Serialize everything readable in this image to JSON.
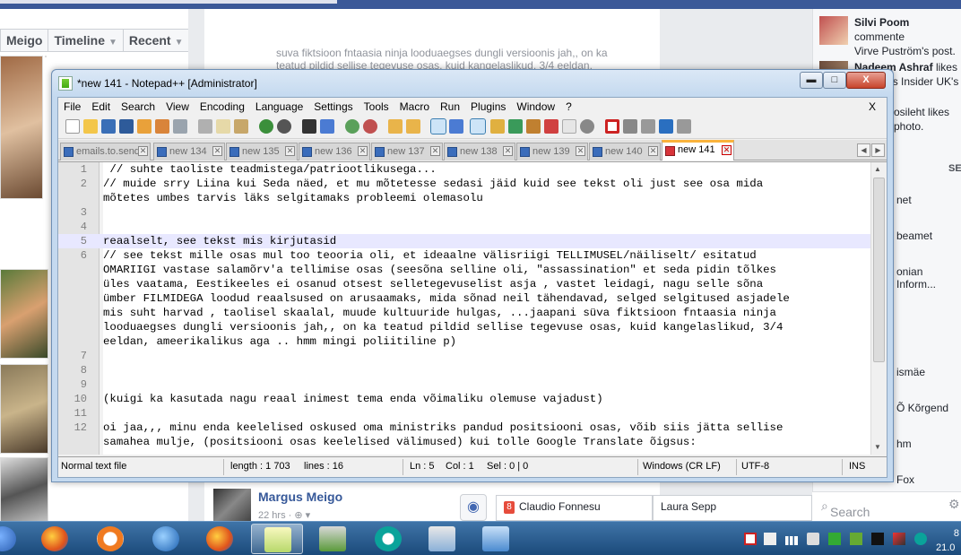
{
  "facebook": {
    "tabs": [
      {
        "label": "Meigo",
        "has_arrow": false
      },
      {
        "label": "Timeline",
        "has_arrow": true
      },
      {
        "label": "Recent",
        "has_arrow": true
      }
    ],
    "post_snippet": "suva fiktsioon fntaasia ninja looduaegses dungli versioonis jah,, on ka teatud pildid sellise tegevuse osas, kuid kangelaslikud, 3/4 eeldan,",
    "post_author": "Margus Meigo",
    "post_time": "22 hrs · ⊕ ▾",
    "chat_tabs": [
      {
        "badge": "8",
        "name": "Claudio Fonnesu"
      },
      {
        "badge": "",
        "name": "Laura Sepp"
      }
    ],
    "ticker": [
      {
        "name": "Silvi Poom",
        "line1": "commente",
        "line2": "Virve Puström's post."
      },
      {
        "name": "Nadeem Ashraf",
        "line1": "likes",
        "line2": "Business Insider UK's"
      },
      {
        "name": "",
        "line1": "osileht likes",
        "line2": "photo."
      }
    ],
    "sidebar_header": "SE",
    "sidebar_names": [
      "net",
      "beamet",
      "onian Inform...",
      "ismäe",
      "Õ Kõrgend",
      "hm",
      "Fox"
    ],
    "search_placeholder": "Search",
    "colors": {
      "topbar": "#3b5998",
      "link": "#365899"
    }
  },
  "notepad": {
    "title": "*new 141 - Notepad++ [Administrator]",
    "window_buttons": {
      "minimize": "▬",
      "maximize": "□",
      "close": "X"
    },
    "menu": [
      "File",
      "Edit",
      "Search",
      "View",
      "Encoding",
      "Language",
      "Settings",
      "Tools",
      "Macro",
      "Run",
      "Plugins",
      "Window",
      "?"
    ],
    "menu_close": "X",
    "tabs": [
      {
        "label": "emails.to.send",
        "active": false
      },
      {
        "label": "new 134",
        "active": false
      },
      {
        "label": "new 135",
        "active": false
      },
      {
        "label": "new 136",
        "active": false
      },
      {
        "label": "new 137",
        "active": false
      },
      {
        "label": "new 138",
        "active": false
      },
      {
        "label": "new 139",
        "active": false
      },
      {
        "label": "new 140",
        "active": false
      },
      {
        "label": "new 141",
        "active": true
      }
    ],
    "lines": [
      {
        "num": "1",
        "text": " // suhte taoliste teadmistega/patriootlikusega..."
      },
      {
        "num": "2",
        "text": "// muide srry Liina kui Seda näed, et mu mõtetesse sedasi jäid kuid see tekst oli just see osa mida"
      },
      {
        "num": "",
        "text": "mõtetes umbes tarvis läks selgitamaks probleemi olemasolu"
      },
      {
        "num": "3",
        "text": ""
      },
      {
        "num": "4",
        "text": ""
      },
      {
        "num": "5",
        "text": "reaalselt, see tekst mis kirjutasid",
        "current": true
      },
      {
        "num": "6",
        "text": "// see tekst mille osas mul too teooria oli, et ideaalne välisriigi TELLIMUSEL/näiliselt/ esitatud"
      },
      {
        "num": "",
        "text": "OMARIIGI vastase salamõrv'a tellimise osas (seesõna selline oli, \"assassination\" et seda pidin tõlkes"
      },
      {
        "num": "",
        "text": "üles vaatama, Eestikeeles ei osanud otsest selletegevuselist asja , vastet leidagi, nagu selle sõna"
      },
      {
        "num": "",
        "text": "ümber FILMIDEGA loodud reaalsused on arusaamaks, mida sõnad neil tähendavad, selged selgitused asjadele"
      },
      {
        "num": "",
        "text": "mis suht harvad , taolisel skaalal, muude kultuuride hulgas, ...jaapani süva fiktsioon fntaasia ninja"
      },
      {
        "num": "",
        "text": "looduaegses dungli versioonis jah,, on ka teatud pildid sellise tegevuse osas, kuid kangelaslikud, 3/4"
      },
      {
        "num": "",
        "text": "eeldan, ameerikalikus aga .. hmm mingi poliitiline p)"
      },
      {
        "num": "7",
        "text": ""
      },
      {
        "num": "8",
        "text": ""
      },
      {
        "num": "9",
        "text": ""
      },
      {
        "num": "10",
        "text": "(kuigi ka kasutada nagu reaal inimest tema enda võimaliku olemuse vajadust)"
      },
      {
        "num": "11",
        "text": ""
      },
      {
        "num": "12",
        "text": "oi jaa,,, minu enda keelelised oskused oma ministriks pandud positsiooni osas, võib siis jätta sellise"
      },
      {
        "num": "",
        "text": "samahea mulje, (positsiooni osas keelelised välimused) kui tolle Google Translate õigsus:"
      }
    ],
    "status": {
      "type": "Normal text file",
      "length": "length : 1 703",
      "lines": "lines : 16",
      "ln": "Ln : 5",
      "col": "Col : 1",
      "sel": "Sel : 0 | 0",
      "eol": "Windows (CR LF)",
      "encoding": "UTF-8",
      "mode": "INS"
    },
    "colors": {
      "active_tab_accent": "#fab33c",
      "current_line": "#e8e8ff"
    }
  },
  "taskbar": {
    "apps": [
      "firefox-icon",
      "avast-icon",
      "thunderbird-icon",
      "firefox-icon",
      "notepadpp-icon",
      "monitor-icon",
      "eset-icon",
      "calculator-icon",
      "picture-viewer-icon"
    ],
    "active_index": 4,
    "clock_time": "8",
    "clock_date": "21.0"
  }
}
